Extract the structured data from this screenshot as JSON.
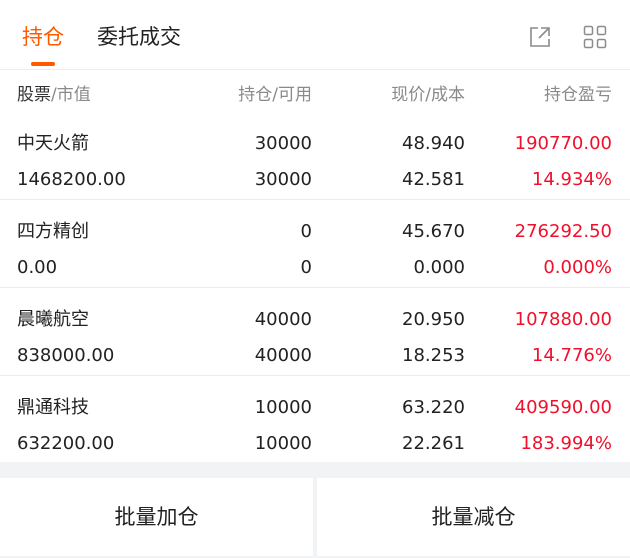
{
  "tabs": {
    "positions": "持仓",
    "orders": "委托成交"
  },
  "header": {
    "stock": "股票",
    "market_value": "/市值",
    "position": "持仓/可用",
    "price": "现价/成本",
    "pnl": "持仓盈亏"
  },
  "rows": [
    {
      "name": "中天火箭",
      "market_value": "1468200.00",
      "position": "30000",
      "available": "30000",
      "price": "48.940",
      "cost": "42.581",
      "pnl": "190770.00",
      "pnl_pct": "14.934%"
    },
    {
      "name": "四方精创",
      "market_value": "0.00",
      "position": "0",
      "available": "0",
      "price": "45.670",
      "cost": "0.000",
      "pnl": "276292.50",
      "pnl_pct": "0.000%"
    },
    {
      "name": "晨曦航空",
      "market_value": "838000.00",
      "position": "40000",
      "available": "40000",
      "price": "20.950",
      "cost": "18.253",
      "pnl": "107880.00",
      "pnl_pct": "14.776%"
    },
    {
      "name": "鼎通科技",
      "market_value": "632200.00",
      "position": "10000",
      "available": "10000",
      "price": "63.220",
      "cost": "22.261",
      "pnl": "409590.00",
      "pnl_pct": "183.994%"
    }
  ],
  "buttons": {
    "batch_add": "批量加仓",
    "batch_reduce": "批量减仓"
  },
  "colors": {
    "accent": "#ff5a00",
    "profit": "#f0102b"
  },
  "icons": [
    "external-link-icon",
    "grid-icon"
  ]
}
